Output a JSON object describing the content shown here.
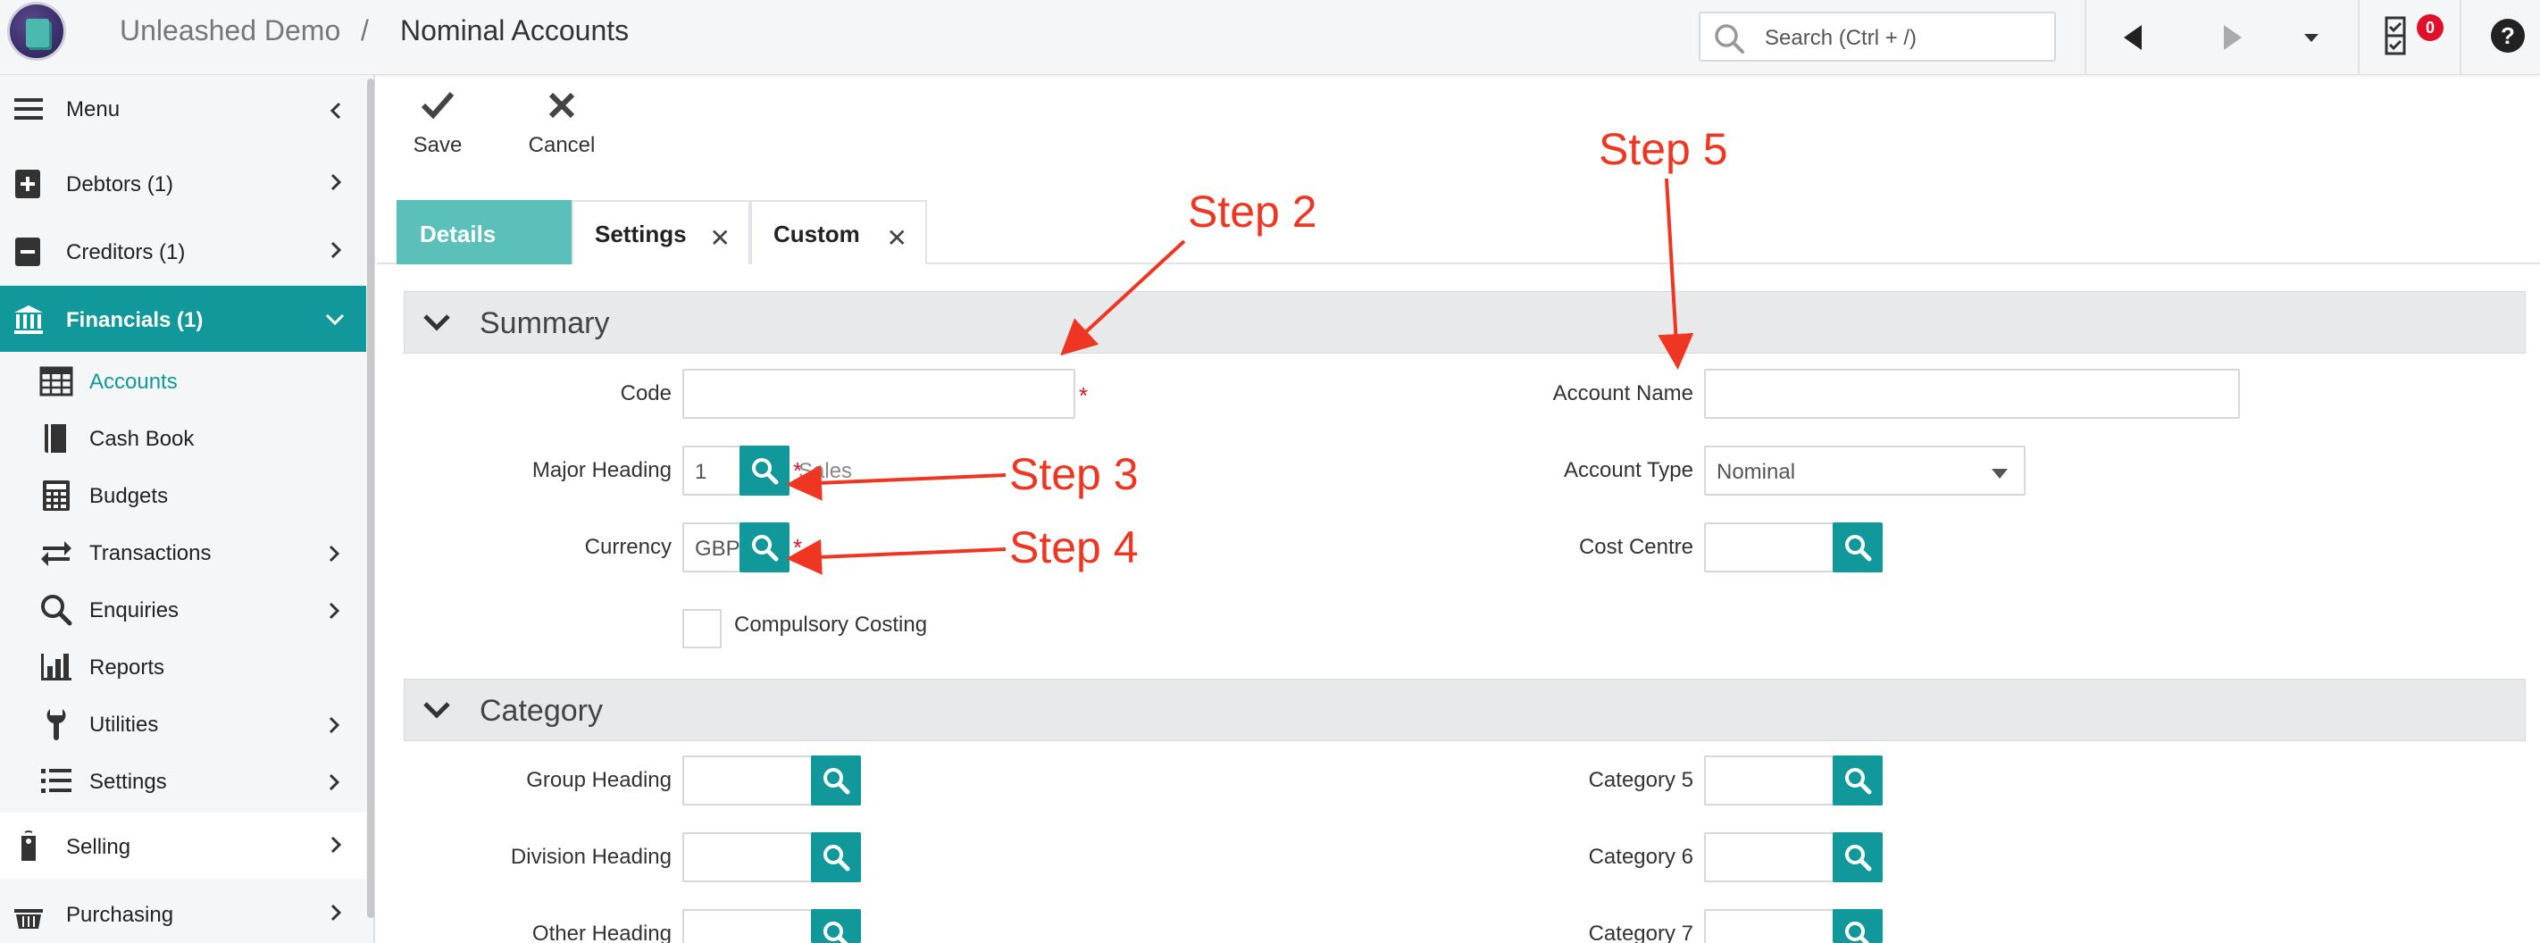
{
  "header": {
    "app_name": "Unleashed Demo",
    "separator": "/",
    "page_title": "Nominal Accounts",
    "search_placeholder": "Search (Ctrl + /)",
    "notification_count": "0"
  },
  "sidebar": {
    "menu_label": "Menu",
    "items": [
      {
        "label": "Debtors (1)",
        "icon": "plus-box-icon"
      },
      {
        "label": "Creditors (1)",
        "icon": "minus-box-icon"
      },
      {
        "label": "Financials (1)",
        "icon": "bank-icon"
      }
    ],
    "financials_sub": [
      {
        "label": "Accounts",
        "icon": "table-icon"
      },
      {
        "label": "Cash Book",
        "icon": "book-icon"
      },
      {
        "label": "Budgets",
        "icon": "calculator-icon"
      },
      {
        "label": "Transactions",
        "icon": "swap-icon"
      },
      {
        "label": "Enquiries",
        "icon": "search-icon"
      },
      {
        "label": "Reports",
        "icon": "bar-chart-icon"
      },
      {
        "label": "Utilities",
        "icon": "wrench-icon"
      },
      {
        "label": "Settings",
        "icon": "list-icon"
      }
    ],
    "bottom_items": [
      {
        "label": "Selling",
        "icon": "tag-icon"
      },
      {
        "label": "Purchasing",
        "icon": "basket-icon"
      }
    ]
  },
  "toolbar": {
    "save_label": "Save",
    "cancel_label": "Cancel"
  },
  "tabs": [
    {
      "label": "Details"
    },
    {
      "label": "Settings",
      "close": "✕"
    },
    {
      "label": "Custom",
      "close": "✕"
    }
  ],
  "summary": {
    "title": "Summary",
    "code_label": "Code",
    "code_value": "",
    "major_heading_label": "Major Heading",
    "major_heading_value": "1",
    "major_heading_hint": "Sales",
    "currency_label": "Currency",
    "currency_value": "GBP",
    "compulsory_costing_label": "Compulsory Costing",
    "account_name_label": "Account Name",
    "account_name_value": "",
    "account_type_label": "Account Type",
    "account_type_value": "Nominal",
    "cost_centre_label": "Cost Centre",
    "required_marker": "*"
  },
  "category": {
    "title": "Category",
    "group_heading_label": "Group Heading",
    "division_heading_label": "Division Heading",
    "other_heading_label": "Other Heading",
    "category5_label": "Category 5",
    "category6_label": "Category 6",
    "category7_label": "Category 7"
  },
  "annotations": {
    "step2": "Step 2",
    "step3": "Step 3",
    "step4": "Step 4",
    "step5": "Step 5"
  },
  "colors": {
    "accent": "#11989a",
    "tab_active": "#5bbfba",
    "annotation": "#ee3622",
    "required": "#e0102a"
  }
}
